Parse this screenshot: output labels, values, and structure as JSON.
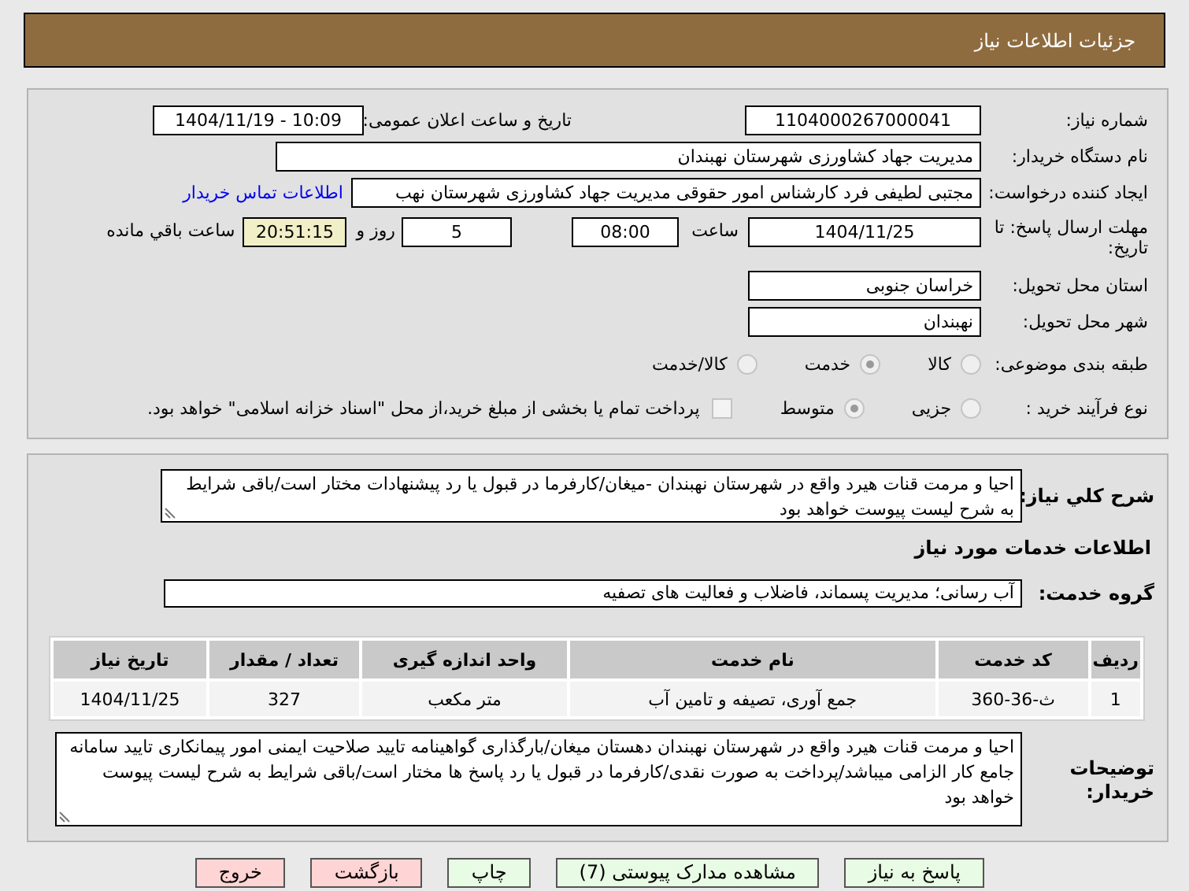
{
  "header": {
    "title": "جزئیات اطلاعات نیاز"
  },
  "need_number": {
    "label": "شماره نیاز:",
    "value": "1104000267000041"
  },
  "announce_date": {
    "label": "تاریخ و ساعت اعلان عمومی:",
    "value": "1404/11/19 - 10:09"
  },
  "buyer_org": {
    "label": "نام دستگاه خریدار:",
    "value": "مدیریت جهاد کشاورزی شهرستان نهبندان"
  },
  "requester": {
    "label": "ایجاد کننده درخواست:",
    "value": "مجتبی لطیفی فرد کارشناس امور حقوقی مدیریت جهاد کشاورزی شهرستان نهب",
    "link": "اطلاعات تماس خریدار"
  },
  "deadline": {
    "label": "مهلت ارسال پاسخ: تا تاریخ:",
    "date": "1404/11/25",
    "time_label": "ساعت",
    "time": "08:00",
    "days": "5",
    "days_label": "روز و",
    "remaining": "20:51:15",
    "remaining_label": "ساعت باقي مانده"
  },
  "province": {
    "label": "استان محل تحویل:",
    "value": "خراسان جنوبی"
  },
  "city": {
    "label": "شهر محل تحویل:",
    "value": "نهبندان"
  },
  "category": {
    "label": "طبقه بندی موضوعی:",
    "options": [
      {
        "label": "کالا",
        "selected": false
      },
      {
        "label": "خدمت",
        "selected": true
      },
      {
        "label": "کالا/خدمت",
        "selected": false
      }
    ]
  },
  "process": {
    "label": "نوع فرآیند خرید :",
    "options": [
      {
        "label": "جزیی",
        "selected": false
      },
      {
        "label": "متوسط",
        "selected": true
      }
    ],
    "treasury": {
      "checked": false,
      "text": "پرداخت تمام یا بخشی از مبلغ خرید،از محل \"اسناد خزانه اسلامی\" خواهد بود."
    }
  },
  "description": {
    "label": "شرح کلي نياز:",
    "value": "احیا و مرمت قنات هیرد واقع در شهرستان نهبندان -میغان/کارفرما در قبول یا رد پیشنهادات مختار است/باقی شرایط به شرح لیست پیوست خواهد بود"
  },
  "services_title": "اطلاعات خدمات مورد نیاز",
  "service_group": {
    "label": "گروه خدمت:",
    "value": "آب رسانی؛ مدیریت پسماند، فاضلاب و فعالیت های تصفیه"
  },
  "table": {
    "columns": [
      "ردیف",
      "کد خدمت",
      "نام خدمت",
      "واحد اندازه گیری",
      "تعداد / مقدار",
      "تاریخ نیاز"
    ],
    "rows": [
      [
        "1",
        "ث-36-360",
        "جمع آوری، تصیفه و تامین آب",
        "متر مکعب",
        "327",
        "1404/11/25"
      ]
    ]
  },
  "buyer_notes": {
    "label": "توضیحات خریدار:",
    "value": "احیا و مرمت قنات هیرد واقع در شهرستان نهبندان دهستان میغان/بارگذاری گواهینامه تایید صلاحیت ایمنی امور پیمانکاری تایید سامانه جامع کار الزامی میباشد/پرداخت به صورت نقدی/کارفرما در قبول یا رد پاسخ ها مختار است/باقی شرایط به شرح لیست پیوست خواهد بود"
  },
  "buttons": [
    {
      "label": "پاسخ به نیاز",
      "kind": "primary"
    },
    {
      "label": "مشاهده مدارک پیوستی (7)",
      "kind": "primary"
    },
    {
      "label": "چاپ",
      "kind": "primary"
    },
    {
      "label": "بازگشت",
      "kind": "danger"
    },
    {
      "label": "خروج",
      "kind": "danger"
    }
  ]
}
